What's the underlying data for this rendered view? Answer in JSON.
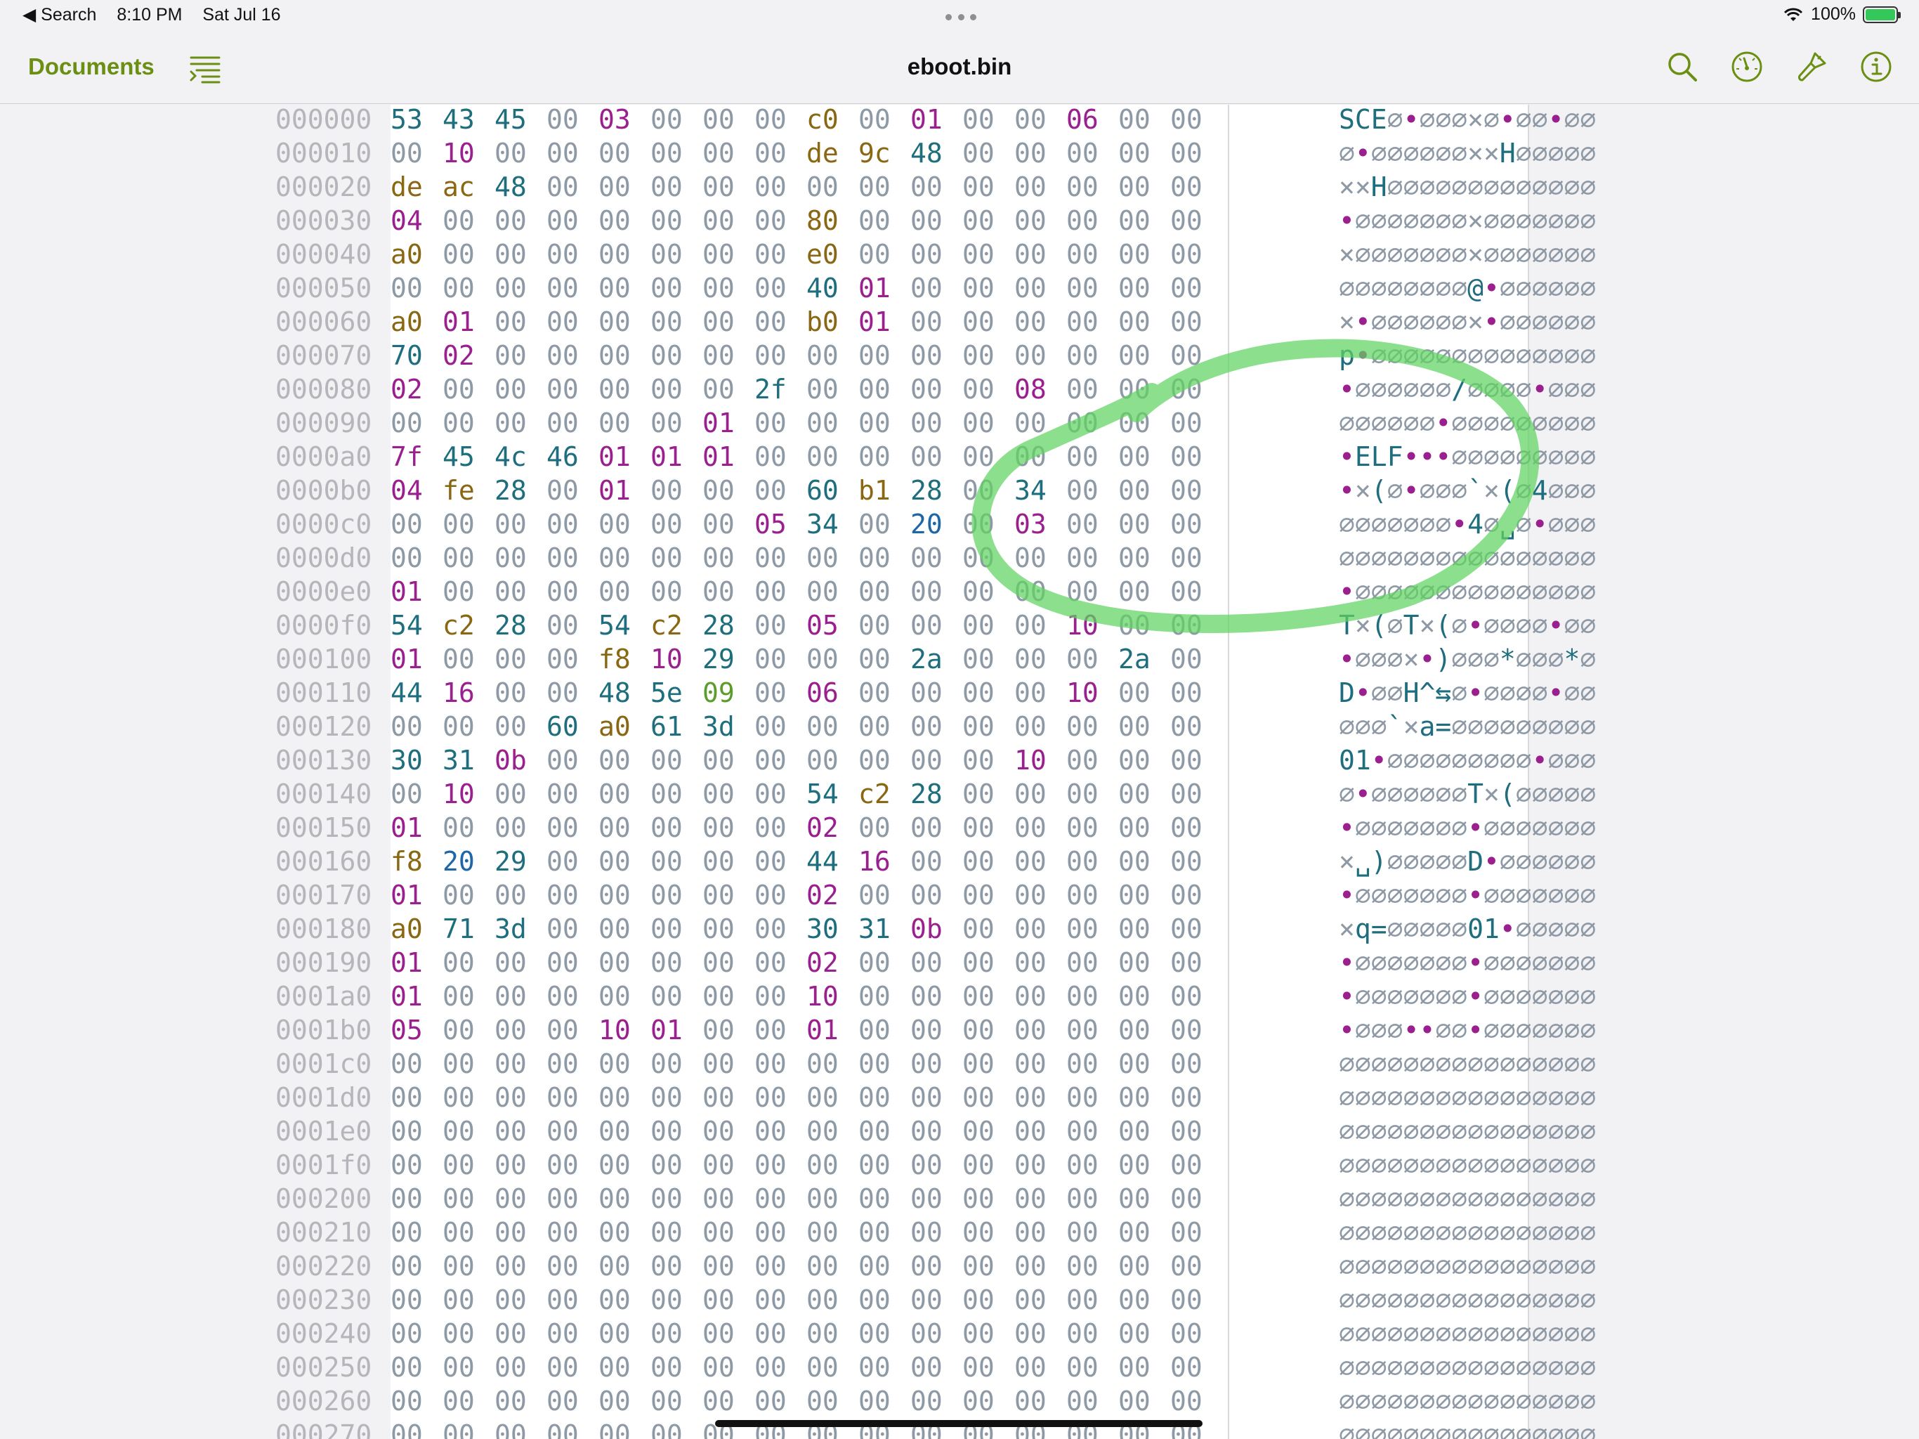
{
  "status_bar": {
    "back_app": "◀ Search",
    "time": "8:10 PM",
    "date": "Sat Jul 16",
    "battery_percent": "100%"
  },
  "nav": {
    "back_label": "Documents",
    "title": "eboot.bin",
    "icons": [
      "list-outline-icon",
      "search-icon",
      "gauge-icon",
      "brush-icon",
      "info-icon"
    ]
  },
  "colors": {
    "accent": "#6b8f12",
    "byte_zero": "#8e99a6",
    "byte_ascii": "#1e6e7e",
    "byte_control": "#9a1f8f",
    "byte_high": "#8a6712",
    "annotation": "#5fd35f"
  },
  "hex_rows": [
    {
      "offset": "000000",
      "bytes": "53 43 45 00 03 00 00 00 c0 00 01 00 00 06 00 00",
      "ascii": "SCE∅•∅∅∅×∅•∅∅•∅∅"
    },
    {
      "offset": "000010",
      "bytes": "00 10 00 00 00 00 00 00 de 9c 48 00 00 00 00 00",
      "ascii": "∅•∅∅∅∅∅∅××H∅∅∅∅∅"
    },
    {
      "offset": "000020",
      "bytes": "de ac 48 00 00 00 00 00 00 00 00 00 00 00 00 00",
      "ascii": "××H∅∅∅∅∅∅∅∅∅∅∅∅∅"
    },
    {
      "offset": "000030",
      "bytes": "04 00 00 00 00 00 00 00 80 00 00 00 00 00 00 00",
      "ascii": "•∅∅∅∅∅∅∅×∅∅∅∅∅∅∅"
    },
    {
      "offset": "000040",
      "bytes": "a0 00 00 00 00 00 00 00 e0 00 00 00 00 00 00 00",
      "ascii": "×∅∅∅∅∅∅∅×∅∅∅∅∅∅∅"
    },
    {
      "offset": "000050",
      "bytes": "00 00 00 00 00 00 00 00 40 01 00 00 00 00 00 00",
      "ascii": "∅∅∅∅∅∅∅∅@•∅∅∅∅∅∅"
    },
    {
      "offset": "000060",
      "bytes": "a0 01 00 00 00 00 00 00 b0 01 00 00 00 00 00 00",
      "ascii": "×•∅∅∅∅∅∅×•∅∅∅∅∅∅"
    },
    {
      "offset": "000070",
      "bytes": "70 02 00 00 00 00 00 00 00 00 00 00 00 00 00 00",
      "ascii": "p•∅∅∅∅∅∅∅∅∅∅∅∅∅∅"
    },
    {
      "offset": "000080",
      "bytes": "02 00 00 00 00 00 00 2f 00 00 00 00 08 00 00 00",
      "ascii": "•∅∅∅∅∅∅/∅∅∅∅•∅∅∅"
    },
    {
      "offset": "000090",
      "bytes": "00 00 00 00 00 00 01 00 00 00 00 00 00 00 00 00",
      "ascii": "∅∅∅∅∅∅•∅∅∅∅∅∅∅∅∅"
    },
    {
      "offset": "0000a0",
      "bytes": "7f 45 4c 46 01 01 01 00 00 00 00 00 00 00 00 00",
      "ascii": "•ELF•••∅∅∅∅∅∅∅∅∅"
    },
    {
      "offset": "0000b0",
      "bytes": "04 fe 28 00 01 00 00 00 60 b1 28 00 34 00 00 00",
      "ascii": "•×(∅•∅∅∅`×(∅4∅∅∅"
    },
    {
      "offset": "0000c0",
      "bytes": "00 00 00 00 00 00 00 05 34 00 20 00 03 00 00 00",
      "ascii": "∅∅∅∅∅∅∅•4∅␣∅•∅∅∅"
    },
    {
      "offset": "0000d0",
      "bytes": "00 00 00 00 00 00 00 00 00 00 00 00 00 00 00 00",
      "ascii": "∅∅∅∅∅∅∅∅∅∅∅∅∅∅∅∅"
    },
    {
      "offset": "0000e0",
      "bytes": "01 00 00 00 00 00 00 00 00 00 00 00 00 00 00 00",
      "ascii": "•∅∅∅∅∅∅∅∅∅∅∅∅∅∅∅"
    },
    {
      "offset": "0000f0",
      "bytes": "54 c2 28 00 54 c2 28 00 05 00 00 00 00 10 00 00",
      "ascii": "T×(∅T×(∅•∅∅∅∅•∅∅"
    },
    {
      "offset": "000100",
      "bytes": "01 00 00 00 f8 10 29 00 00 00 2a 00 00 00 2a 00",
      "ascii": "•∅∅∅×•)∅∅∅*∅∅∅*∅"
    },
    {
      "offset": "000110",
      "bytes": "44 16 00 00 48 5e 09 00 06 00 00 00 00 10 00 00",
      "ascii": "D•∅∅H^⇆∅•∅∅∅∅•∅∅"
    },
    {
      "offset": "000120",
      "bytes": "00 00 00 60 a0 61 3d 00 00 00 00 00 00 00 00 00",
      "ascii": "∅∅∅`×a=∅∅∅∅∅∅∅∅∅"
    },
    {
      "offset": "000130",
      "bytes": "30 31 0b 00 00 00 00 00 00 00 00 00 10 00 00 00",
      "ascii": "01•∅∅∅∅∅∅∅∅∅•∅∅∅"
    },
    {
      "offset": "000140",
      "bytes": "00 10 00 00 00 00 00 00 54 c2 28 00 00 00 00 00",
      "ascii": "∅•∅∅∅∅∅∅T×(∅∅∅∅∅"
    },
    {
      "offset": "000150",
      "bytes": "01 00 00 00 00 00 00 00 02 00 00 00 00 00 00 00",
      "ascii": "•∅∅∅∅∅∅∅•∅∅∅∅∅∅∅"
    },
    {
      "offset": "000160",
      "bytes": "f8 20 29 00 00 00 00 00 44 16 00 00 00 00 00 00",
      "ascii": "×␣)∅∅∅∅∅D•∅∅∅∅∅∅"
    },
    {
      "offset": "000170",
      "bytes": "01 00 00 00 00 00 00 00 02 00 00 00 00 00 00 00",
      "ascii": "•∅∅∅∅∅∅∅•∅∅∅∅∅∅∅"
    },
    {
      "offset": "000180",
      "bytes": "a0 71 3d 00 00 00 00 00 30 31 0b 00 00 00 00 00",
      "ascii": "×q=∅∅∅∅∅01•∅∅∅∅∅"
    },
    {
      "offset": "000190",
      "bytes": "01 00 00 00 00 00 00 00 02 00 00 00 00 00 00 00",
      "ascii": "•∅∅∅∅∅∅∅•∅∅∅∅∅∅∅"
    },
    {
      "offset": "0001a0",
      "bytes": "01 00 00 00 00 00 00 00 10 00 00 00 00 00 00 00",
      "ascii": "•∅∅∅∅∅∅∅•∅∅∅∅∅∅∅"
    },
    {
      "offset": "0001b0",
      "bytes": "05 00 00 00 10 01 00 00 01 00 00 00 00 00 00 00",
      "ascii": "•∅∅∅••∅∅•∅∅∅∅∅∅∅"
    },
    {
      "offset": "0001c0",
      "bytes": "00 00 00 00 00 00 00 00 00 00 00 00 00 00 00 00",
      "ascii": "∅∅∅∅∅∅∅∅∅∅∅∅∅∅∅∅"
    },
    {
      "offset": "0001d0",
      "bytes": "00 00 00 00 00 00 00 00 00 00 00 00 00 00 00 00",
      "ascii": "∅∅∅∅∅∅∅∅∅∅∅∅∅∅∅∅"
    },
    {
      "offset": "0001e0",
      "bytes": "00 00 00 00 00 00 00 00 00 00 00 00 00 00 00 00",
      "ascii": "∅∅∅∅∅∅∅∅∅∅∅∅∅∅∅∅"
    },
    {
      "offset": "0001f0",
      "bytes": "00 00 00 00 00 00 00 00 00 00 00 00 00 00 00 00",
      "ascii": "∅∅∅∅∅∅∅∅∅∅∅∅∅∅∅∅"
    },
    {
      "offset": "000200",
      "bytes": "00 00 00 00 00 00 00 00 00 00 00 00 00 00 00 00",
      "ascii": "∅∅∅∅∅∅∅∅∅∅∅∅∅∅∅∅"
    },
    {
      "offset": "000210",
      "bytes": "00 00 00 00 00 00 00 00 00 00 00 00 00 00 00 00",
      "ascii": "∅∅∅∅∅∅∅∅∅∅∅∅∅∅∅∅"
    },
    {
      "offset": "000220",
      "bytes": "00 00 00 00 00 00 00 00 00 00 00 00 00 00 00 00",
      "ascii": "∅∅∅∅∅∅∅∅∅∅∅∅∅∅∅∅"
    },
    {
      "offset": "000230",
      "bytes": "00 00 00 00 00 00 00 00 00 00 00 00 00 00 00 00",
      "ascii": "∅∅∅∅∅∅∅∅∅∅∅∅∅∅∅∅"
    },
    {
      "offset": "000240",
      "bytes": "00 00 00 00 00 00 00 00 00 00 00 00 00 00 00 00",
      "ascii": "∅∅∅∅∅∅∅∅∅∅∅∅∅∅∅∅"
    },
    {
      "offset": "000250",
      "bytes": "00 00 00 00 00 00 00 00 00 00 00 00 00 00 00 00",
      "ascii": "∅∅∅∅∅∅∅∅∅∅∅∅∅∅∅∅"
    },
    {
      "offset": "000260",
      "bytes": "00 00 00 00 00 00 00 00 00 00 00 00 00 00 00 00",
      "ascii": "∅∅∅∅∅∅∅∅∅∅∅∅∅∅∅∅"
    },
    {
      "offset": "000270",
      "bytes": "00 00 00 00 00 00 00 00 00 00 00 00 00 00 00 00",
      "ascii": "∅∅∅∅∅∅∅∅∅∅∅∅∅∅∅∅"
    }
  ]
}
